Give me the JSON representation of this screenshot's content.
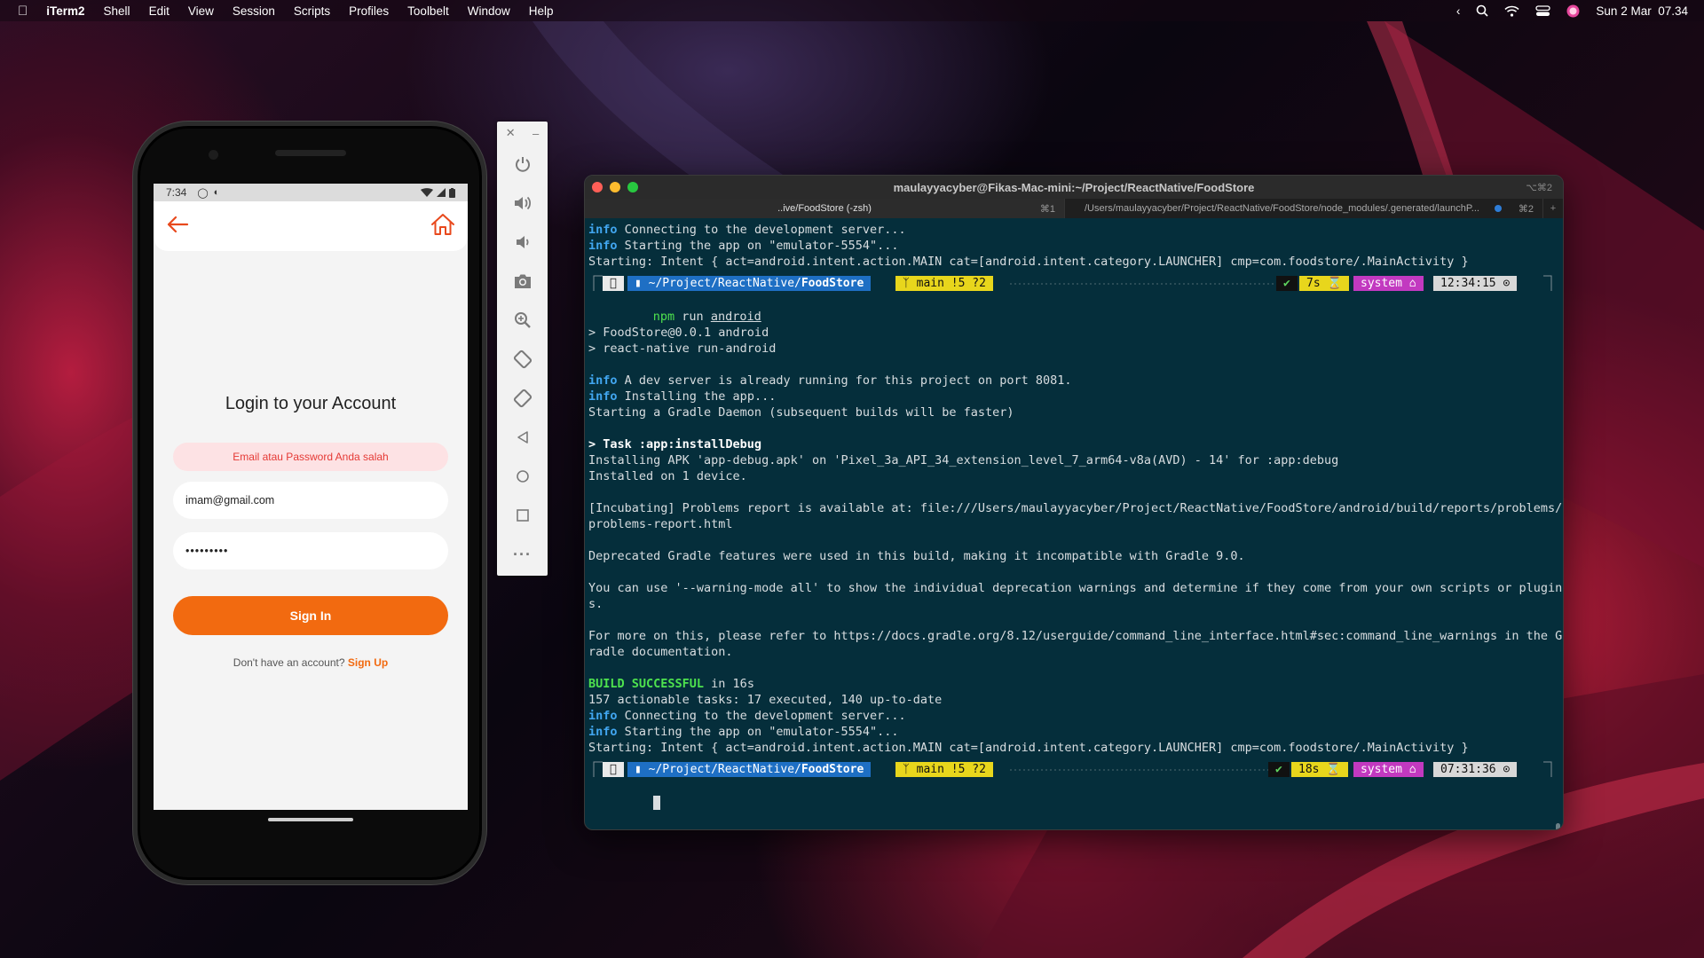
{
  "menubar": {
    "app": "iTerm2",
    "items": [
      "Shell",
      "Edit",
      "View",
      "Session",
      "Scripts",
      "Profiles",
      "Toolbelt",
      "Window",
      "Help"
    ],
    "datetime": "Sun 2 Mar  07.34"
  },
  "phone": {
    "status_time": "7:34",
    "login_title": "Login to your Account",
    "error_message": "Email atau Password Anda salah",
    "email_value": "imam@gmail.com",
    "password_value": "•••••••••",
    "signin_label": "Sign In",
    "no_account_text": "Don't have an account?",
    "signup_label": "Sign Up",
    "accent_color": "#f26a10"
  },
  "emulator": {
    "buttons": [
      "power-icon",
      "volume-up-icon",
      "volume-down-icon",
      "camera-icon",
      "zoom-icon",
      "rotate-left-icon",
      "rotate-right-icon",
      "back-icon",
      "home-icon",
      "overview-icon",
      "more-icon"
    ]
  },
  "terminal": {
    "title": "maulayyacyber@Fikas-Mac-mini:~/Project/ReactNative/FoodStore",
    "title_shortcut": "⌥⌘2",
    "tabs": [
      {
        "label": "..ive/FoodStore (-zsh)",
        "shortcut": "⌘1"
      },
      {
        "label": "/Users/maulayyacyber/Project/ReactNative/FoodStore/node_modules/.generated/launchP...",
        "shortcut": "⌘2"
      }
    ],
    "lines1": [
      {
        "tag": "info",
        "text": " Connecting to the development server..."
      },
      {
        "tag": "info",
        "text": " Starting the app on \"emulator-5554\"..."
      },
      {
        "tag": "",
        "text": "Starting: Intent { act=android.intent.action.MAIN cat=[android.intent.category.LAUNCHER] cmp=com.foodstore/.MainActivity }"
      }
    ],
    "prompt1": {
      "path": " ~/Project/ReactNative/",
      "dir": "FoodStore",
      "git": " main !5 ?2",
      "status": "✔",
      "duration": "7s ⌛",
      "env": "system ⌂",
      "time": "12:34:15 ⊙"
    },
    "command": "npm",
    "command_args": " run ",
    "command_target": "android",
    "lines2": [
      {
        "tag": "",
        "text": ""
      },
      {
        "tag": "",
        "text": "> FoodStore@0.0.1 android"
      },
      {
        "tag": "",
        "text": "> react-native run-android"
      },
      {
        "tag": "",
        "text": ""
      },
      {
        "tag": "info",
        "text": " A dev server is already running for this project on port 8081."
      },
      {
        "tag": "info",
        "text": " Installing the app..."
      },
      {
        "tag": "",
        "text": "Starting a Gradle Daemon (subsequent builds will be faster)"
      },
      {
        "tag": "",
        "text": ""
      },
      {
        "tag": "bold",
        "text": "> Task :app:installDebug"
      },
      {
        "tag": "",
        "text": "Installing APK 'app-debug.apk' on 'Pixel_3a_API_34_extension_level_7_arm64-v8a(AVD) - 14' for :app:debug"
      },
      {
        "tag": "",
        "text": "Installed on 1 device."
      },
      {
        "tag": "",
        "text": ""
      },
      {
        "tag": "",
        "text": "[Incubating] Problems report is available at: file:///Users/maulayyacyber/Project/ReactNative/FoodStore/android/build/reports/problems/"
      },
      {
        "tag": "",
        "text": "problems-report.html"
      },
      {
        "tag": "",
        "text": ""
      },
      {
        "tag": "",
        "text": "Deprecated Gradle features were used in this build, making it incompatible with Gradle 9.0."
      },
      {
        "tag": "",
        "text": ""
      },
      {
        "tag": "",
        "text": "You can use '--warning-mode all' to show the individual deprecation warnings and determine if they come from your own scripts or plugin"
      },
      {
        "tag": "",
        "text": "s."
      },
      {
        "tag": "",
        "text": ""
      },
      {
        "tag": "",
        "text": "For more on this, please refer to https://docs.gradle.org/8.12/userguide/command_line_interface.html#sec:command_line_warnings in the G"
      },
      {
        "tag": "",
        "text": "radle documentation."
      },
      {
        "tag": "",
        "text": ""
      },
      {
        "tag": "success",
        "text": " in 16s",
        "prefix": "BUILD SUCCESSFUL"
      },
      {
        "tag": "",
        "text": "157 actionable tasks: 17 executed, 140 up-to-date"
      },
      {
        "tag": "info",
        "text": " Connecting to the development server..."
      },
      {
        "tag": "info",
        "text": " Starting the app on \"emulator-5554\"..."
      },
      {
        "tag": "",
        "text": "Starting: Intent { act=android.intent.action.MAIN cat=[android.intent.category.LAUNCHER] cmp=com.foodstore/.MainActivity }"
      }
    ],
    "prompt2": {
      "path": " ~/Project/ReactNative/",
      "dir": "FoodStore",
      "git": " main !5 ?2",
      "status": "✔",
      "duration": "18s ⌛",
      "env": "system ⌂",
      "time": "07:31:36 ⊙"
    }
  }
}
